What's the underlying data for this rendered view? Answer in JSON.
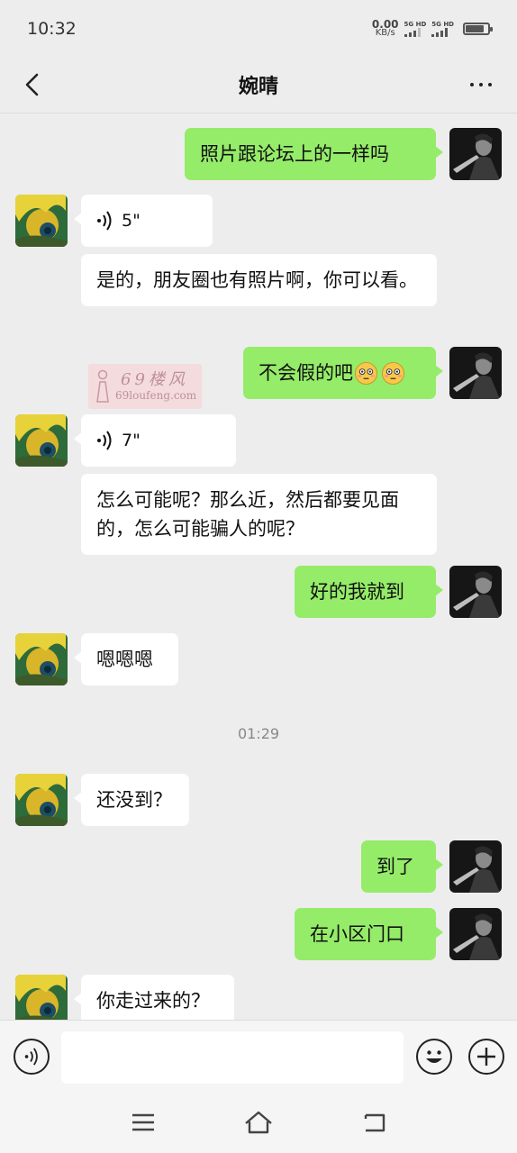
{
  "status": {
    "time": "10:32",
    "net_speed_value": "0.00",
    "net_speed_unit": "KB/s",
    "sim1_label": "5G HD",
    "sim2_label": "5G HD",
    "battery_level": 0.85
  },
  "header": {
    "title": "婉晴"
  },
  "messages": [
    {
      "side": "right",
      "type": "text",
      "text": "照片跟论坛上的一样吗"
    },
    {
      "side": "left",
      "type": "voice",
      "duration": "5\""
    },
    {
      "side": "left",
      "type": "text",
      "text": "是的，朋友圈也有照片啊，你可以看。"
    },
    {
      "side": "right",
      "type": "text",
      "text": "不会假的吧",
      "emoji": "flushed-face-icon x2"
    },
    {
      "side": "left",
      "type": "voice",
      "duration": "7\""
    },
    {
      "side": "left",
      "type": "text",
      "text": "怎么可能呢？那么近，然后都要见面的，怎么可能骗人的呢？"
    },
    {
      "side": "right",
      "type": "text",
      "text": "好的我就到"
    },
    {
      "side": "left",
      "type": "text",
      "text": "嗯嗯嗯"
    },
    {
      "side": "left",
      "type": "text",
      "text": "还没到？"
    },
    {
      "side": "right",
      "type": "text",
      "text": "到了"
    },
    {
      "side": "right",
      "type": "text",
      "text": "在小区门口"
    },
    {
      "side": "left",
      "type": "text",
      "text": "你走过来的？"
    }
  ],
  "timestamp_separator": "01:29",
  "watermark": {
    "cn": "69楼风",
    "en": "69loufeng.com"
  },
  "input": {
    "value": "",
    "placeholder": ""
  },
  "icons": {
    "back": "back-arrow-icon",
    "more": "more-dots-icon",
    "voice": "voice-wave-icon",
    "emoji": "emoji-smile-icon",
    "plus": "plus-icon",
    "nav_menu": "menu-icon",
    "nav_home": "home-icon",
    "nav_back": "back-nav-icon"
  },
  "colors": {
    "self_bubble": "#95ec69",
    "other_bubble": "#ffffff",
    "background": "#ededed"
  }
}
